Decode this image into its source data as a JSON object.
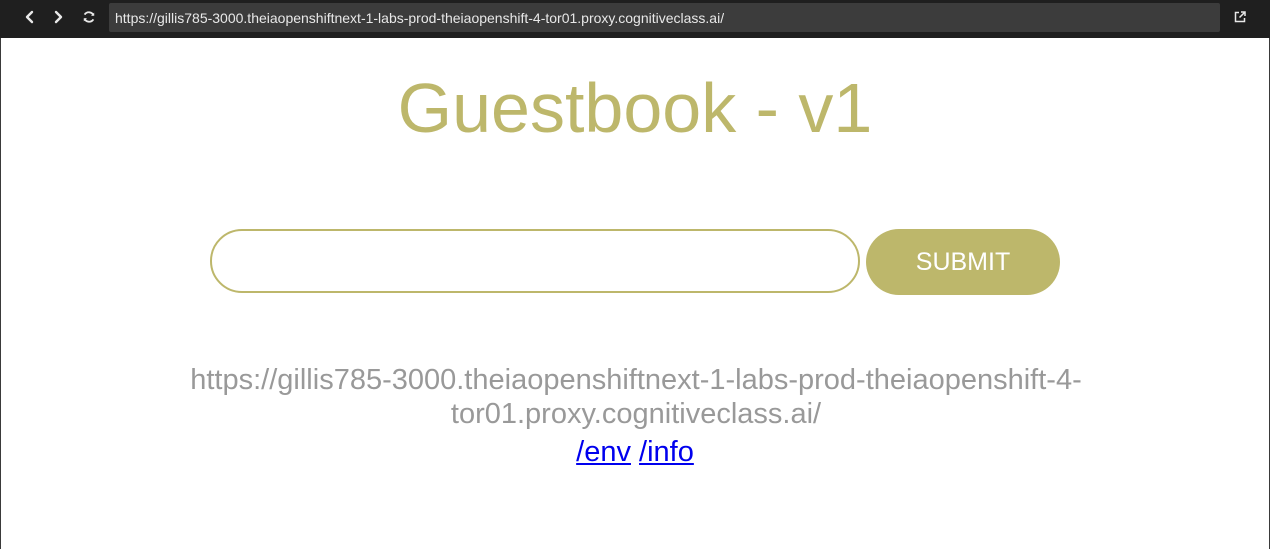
{
  "browser": {
    "url": "https://gillis785-3000.theiaopenshiftnext-1-labs-prod-theiaopenshift-4-tor01.proxy.cognitiveclass.ai/",
    "icons": {
      "back": "chevron-left-icon",
      "forward": "chevron-right-icon",
      "reload": "reload-icon",
      "open_external": "open-external-icon"
    }
  },
  "page": {
    "title": "Guestbook - v1",
    "entry_value": "",
    "submit_label": "SUBMIT",
    "host_url": "https://gillis785-3000.theiaopenshiftnext-1-labs-prod-theiaopenshift-4-tor01.proxy.cognitiveclass.ai/",
    "links": [
      {
        "label": "/env"
      },
      {
        "label": "/info"
      }
    ]
  },
  "colors": {
    "accent": "#bdb76b",
    "muted_text": "#999999",
    "link": "#0000ee",
    "toolbar_bg": "#1f1f1f",
    "url_bar_bg": "#3c3c3c"
  }
}
